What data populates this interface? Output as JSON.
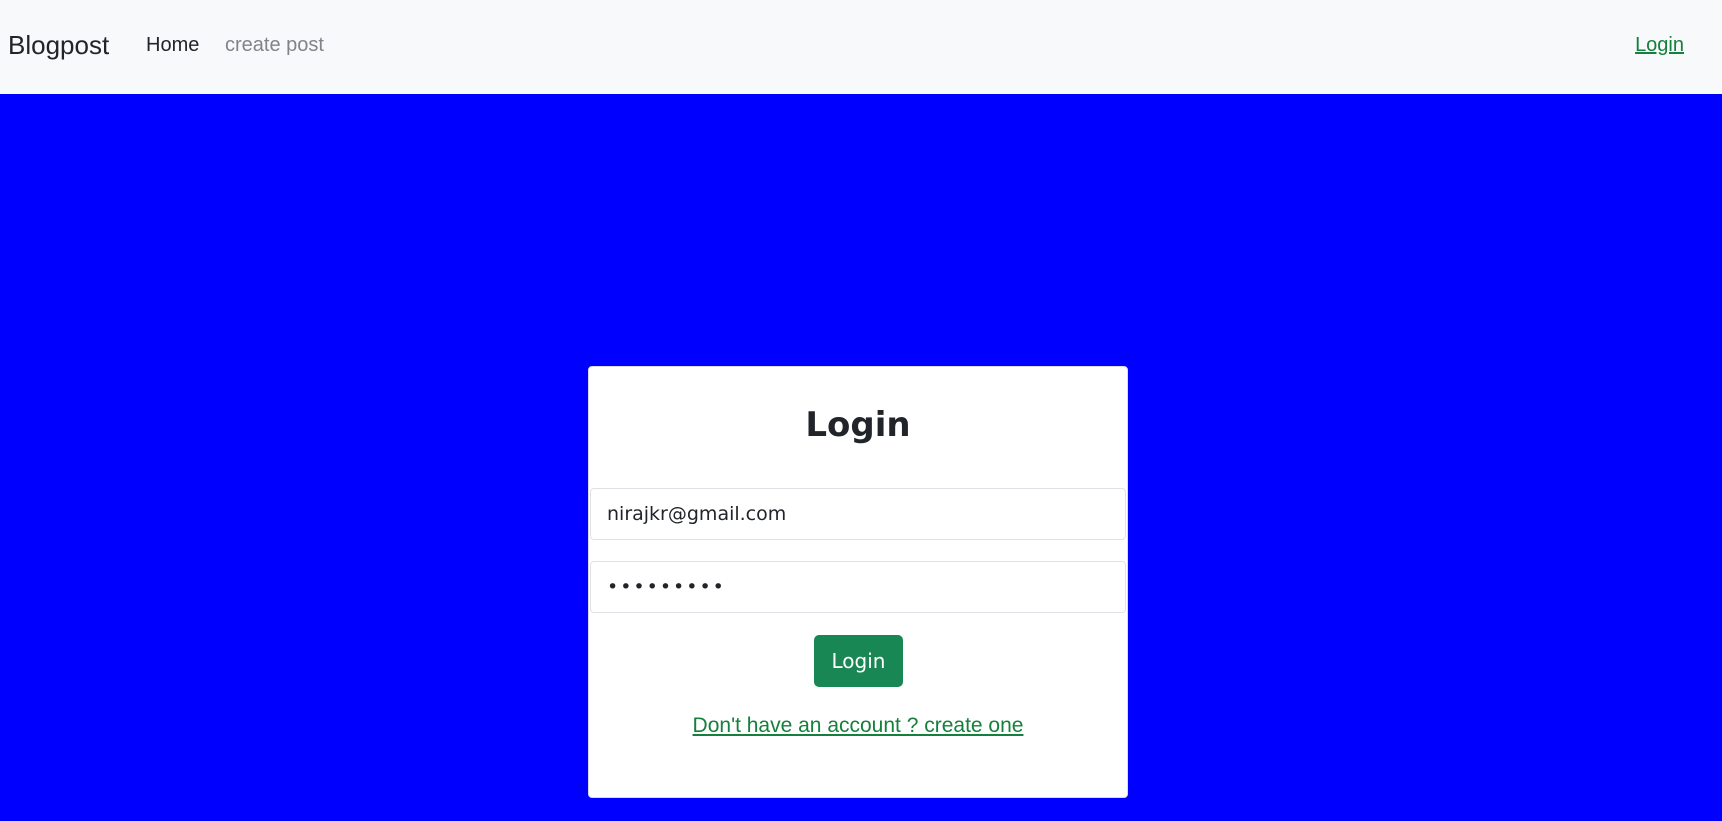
{
  "navbar": {
    "brand": "Blogpost",
    "links": [
      {
        "label": "Home"
      },
      {
        "label": "create post"
      }
    ],
    "login_link": "Login"
  },
  "login_card": {
    "title": "Login",
    "email_value": "nirajkr@gmail.com",
    "password_value": "•••••••••",
    "submit_label": "Login",
    "signup_link": "Don't have an account ? create one"
  },
  "colors": {
    "background": "#0000ff",
    "navbar_bg": "#f8f9fa",
    "button_bg": "#198754",
    "link_color": "#15803d"
  }
}
